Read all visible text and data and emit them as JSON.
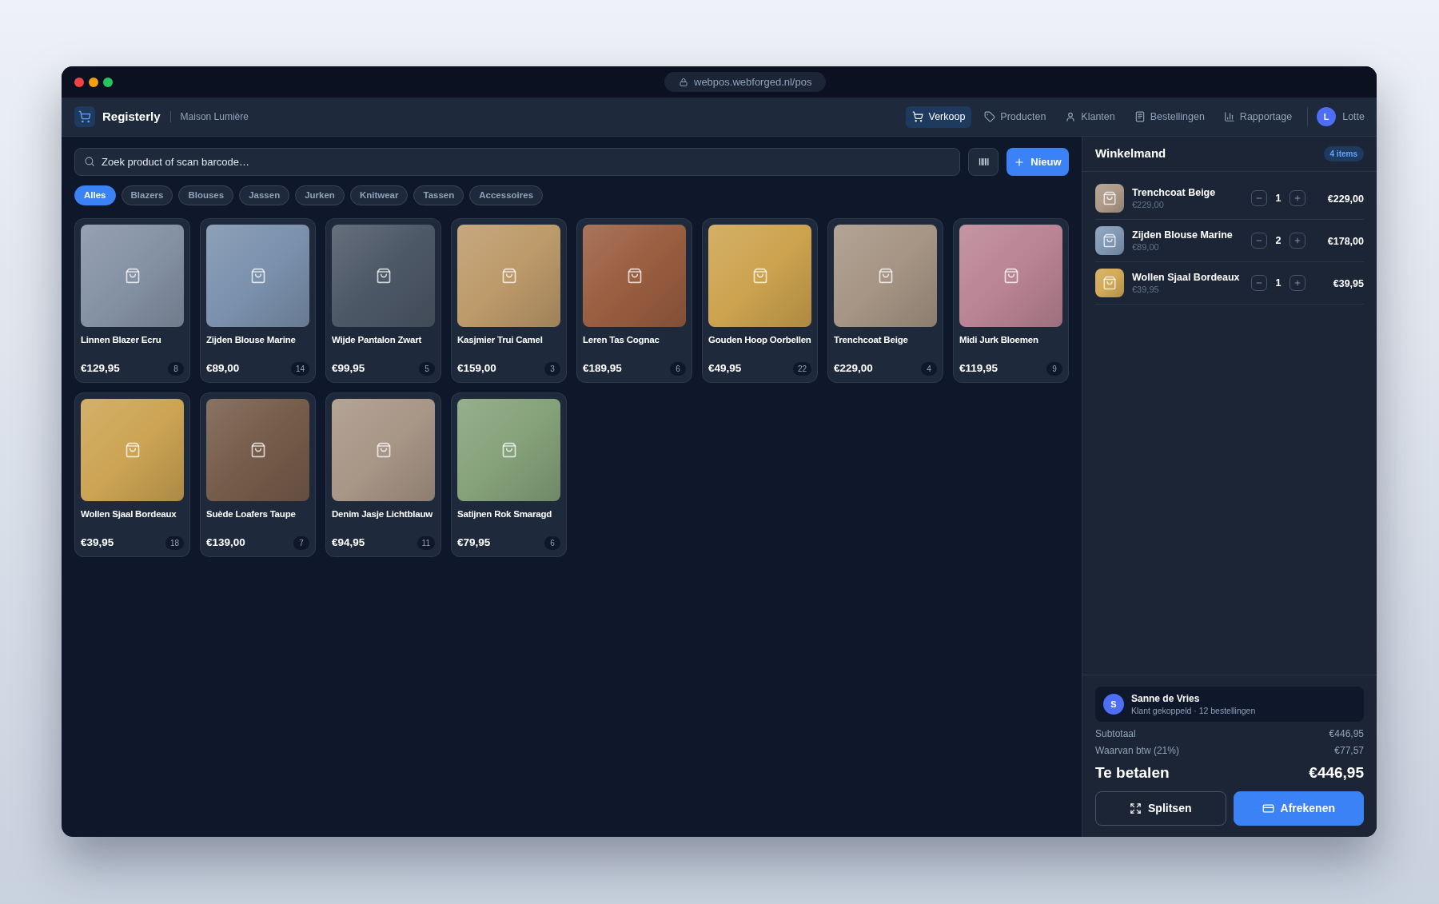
{
  "window": {
    "url": "webpos.webforged.nl/pos"
  },
  "app_header": {
    "brand": "Registerly",
    "store": "Maison Lumière",
    "nav": [
      {
        "label": "Verkoop",
        "selected": true
      },
      {
        "label": "Producten",
        "selected": false
      },
      {
        "label": "Klanten",
        "selected": false
      },
      {
        "label": "Bestellingen",
        "selected": false
      },
      {
        "label": "Rapportage",
        "selected": false
      }
    ],
    "user": {
      "initial": "L",
      "name": "Lotte"
    }
  },
  "search": {
    "placeholder": "Zoek product of scan barcode…"
  },
  "new_button": "Nieuw",
  "categories": [
    {
      "label": "Alles",
      "selected": true
    },
    {
      "label": "Blazers",
      "selected": false
    },
    {
      "label": "Blouses",
      "selected": false
    },
    {
      "label": "Jassen",
      "selected": false
    },
    {
      "label": "Jurken",
      "selected": false
    },
    {
      "label": "Knitwear",
      "selected": false
    },
    {
      "label": "Tassen",
      "selected": false
    },
    {
      "label": "Accessoires",
      "selected": false
    }
  ],
  "products": [
    {
      "name": "Linnen Blazer Ecru",
      "price": "€129,95",
      "stock": "8",
      "color": "#8592a5"
    },
    {
      "name": "Zijden Blouse Marine",
      "price": "€89,00",
      "stock": "14",
      "color": "#7b91ad"
    },
    {
      "name": "Wijde Pantalon Zwart",
      "price": "€99,95",
      "stock": "5",
      "color": "#4d5867"
    },
    {
      "name": "Kasjmier Trui Camel",
      "price": "€159,00",
      "stock": "3",
      "color": "#bd9a6a"
    },
    {
      "name": "Leren Tas Cognac",
      "price": "€189,95",
      "stock": "6",
      "color": "#9a5e40"
    },
    {
      "name": "Gouden Hoop Oorbellen",
      "price": "€49,95",
      "stock": "22",
      "color": "#cda34f"
    },
    {
      "name": "Trenchcoat Beige",
      "price": "€229,00",
      "stock": "4",
      "color": "#a69584"
    },
    {
      "name": "Midi Jurk Bloemen",
      "price": "€119,95",
      "stock": "9",
      "color": "#ba8494"
    },
    {
      "name": "Wollen Sjaal Bordeaux",
      "price": "€39,95",
      "stock": "18",
      "color": "#cca453"
    },
    {
      "name": "Suède Loafers Taupe",
      "price": "€139,00",
      "stock": "7",
      "color": "#765c4a"
    },
    {
      "name": "Denim Jasje Lichtblauw",
      "price": "€94,95",
      "stock": "11",
      "color": "#a89686"
    },
    {
      "name": "Satijnen Rok Smaragd",
      "price": "€79,95",
      "stock": "6",
      "color": "#85a27a"
    }
  ],
  "cart": {
    "title": "Winkelmand",
    "count": "4 items",
    "items": [
      {
        "name": "Trenchcoat Beige",
        "unit_price": "€229,00",
        "quantity": "1",
        "line_total": "€229,00",
        "color": "#ad9a88"
      },
      {
        "name": "Zijden Blouse Marine",
        "unit_price": "€89,00",
        "quantity": "2",
        "line_total": "€178,00",
        "color": "#8299b5"
      },
      {
        "name": "Wollen Sjaal Bordeaux",
        "unit_price": "€39,95",
        "quantity": "1",
        "line_total": "€39,95",
        "color": "#d2a957"
      }
    ],
    "customer": {
      "initial": "S",
      "name": "Sanne de Vries",
      "detail": "Klant gekoppeld · 12 bestellingen"
    },
    "summary": [
      {
        "label": "Subtotaal",
        "value": "€446,95"
      },
      {
        "label": "Waarvan btw (21%)",
        "value": "€77,57"
      }
    ],
    "total": {
      "label": "Te betalen",
      "value": "€446,95"
    },
    "actions": [
      {
        "label": "Splitsen",
        "kind": "secondary"
      },
      {
        "label": "Afrekenen",
        "kind": "primary"
      }
    ]
  }
}
